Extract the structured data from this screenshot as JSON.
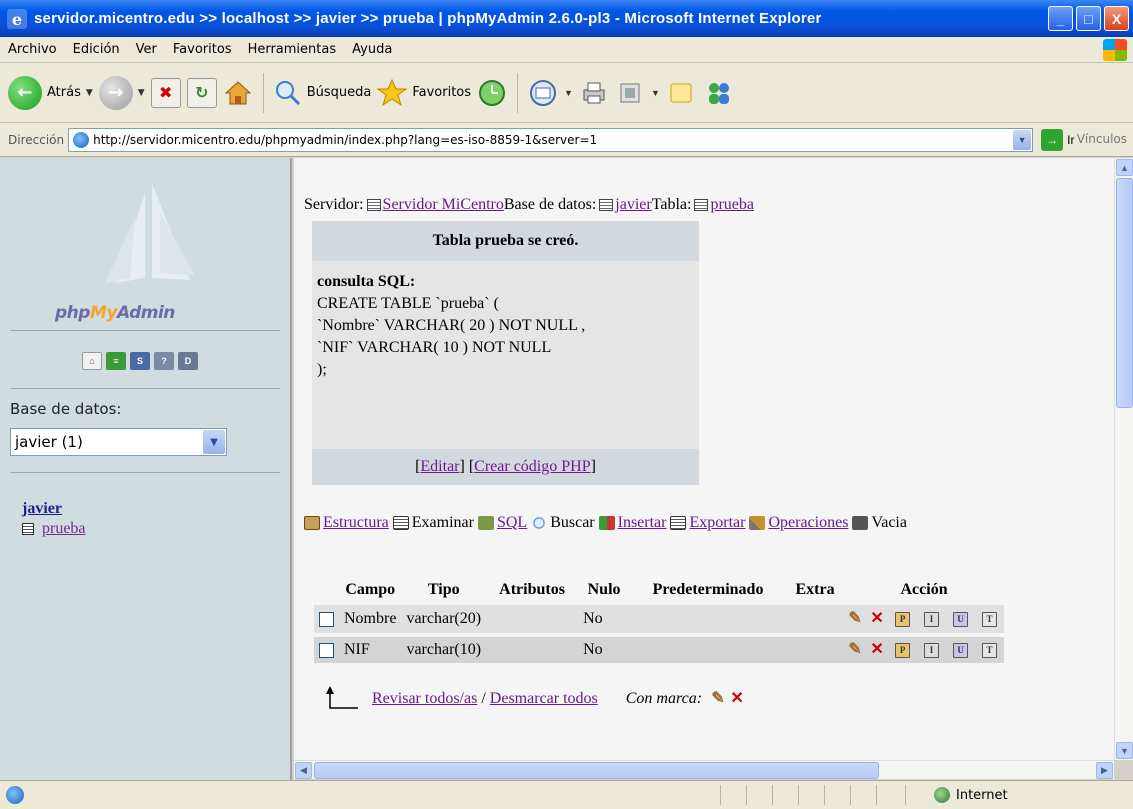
{
  "window": {
    "title": "servidor.micentro.edu >> localhost >> javier >> prueba | phpMyAdmin 2.6.0-pl3 - Microsoft Internet Explorer",
    "minimize": "_",
    "maximize": "□",
    "close": "X"
  },
  "menu": [
    "Archivo",
    "Edición",
    "Ver",
    "Favoritos",
    "Herramientas",
    "Ayuda"
  ],
  "toolbar": {
    "back_label": "Atrás",
    "search_label": "Búsqueda",
    "favorites_label": "Favoritos"
  },
  "address": {
    "label": "Dirección",
    "url": "http://servidor.micentro.edu/phpmyadmin/index.php?lang=es-iso-8859-1&server=1",
    "go_label": "Ir",
    "links_label": "Vínculos"
  },
  "left": {
    "logo_php": "php",
    "logo_my": "My",
    "logo_admin": "Admin",
    "db_label": "Base de datos:",
    "db_selected": "javier (1)",
    "db_link": "javier",
    "table_link": "prueba"
  },
  "main": {
    "breadcrumb": {
      "server_label": "Servidor:",
      "server_name": "Servidor MiCentro",
      "db_label": "Base de datos:",
      "db_name": "javier",
      "table_label": "Tabla:",
      "table_name": "prueba"
    },
    "message": {
      "header": "Tabla prueba se creó.",
      "sql_label": "consulta SQL:",
      "sql": "CREATE TABLE `prueba` (\n`Nombre` VARCHAR( 20 ) NOT NULL ,\n`NIF` VARCHAR( 10 ) NOT NULL\n);",
      "edit_link": "Editar",
      "php_link": "Crear código PHP",
      "bracket_open": "[",
      "bracket_close": "]"
    },
    "tabs": {
      "structure": "Estructura",
      "browse": "Examinar",
      "sql": "SQL",
      "search": "Buscar",
      "insert": "Insertar",
      "export": "Exportar",
      "operations": "Operaciones",
      "empty": "Vacia"
    },
    "table": {
      "headers": [
        "Campo",
        "Tipo",
        "Atributos",
        "Nulo",
        "Predeterminado",
        "Extra",
        "Acción"
      ],
      "rows": [
        {
          "campo": "Nombre",
          "tipo": "varchar(20)",
          "atributos": "",
          "nulo": "No",
          "predeterminado": "",
          "extra": ""
        },
        {
          "campo": "NIF",
          "tipo": "varchar(10)",
          "atributos": "",
          "nulo": "No",
          "predeterminado": "",
          "extra": ""
        }
      ]
    },
    "check_all": "Revisar todos/as",
    "separator": "/",
    "uncheck_all": "Desmarcar todos",
    "with_selected": "Con marca:"
  },
  "status": {
    "zone": "Internet"
  },
  "colors": {
    "titlebar": "#0a50d8",
    "link_visited": "#6a1b8a",
    "left_bg": "#d0dce0"
  }
}
